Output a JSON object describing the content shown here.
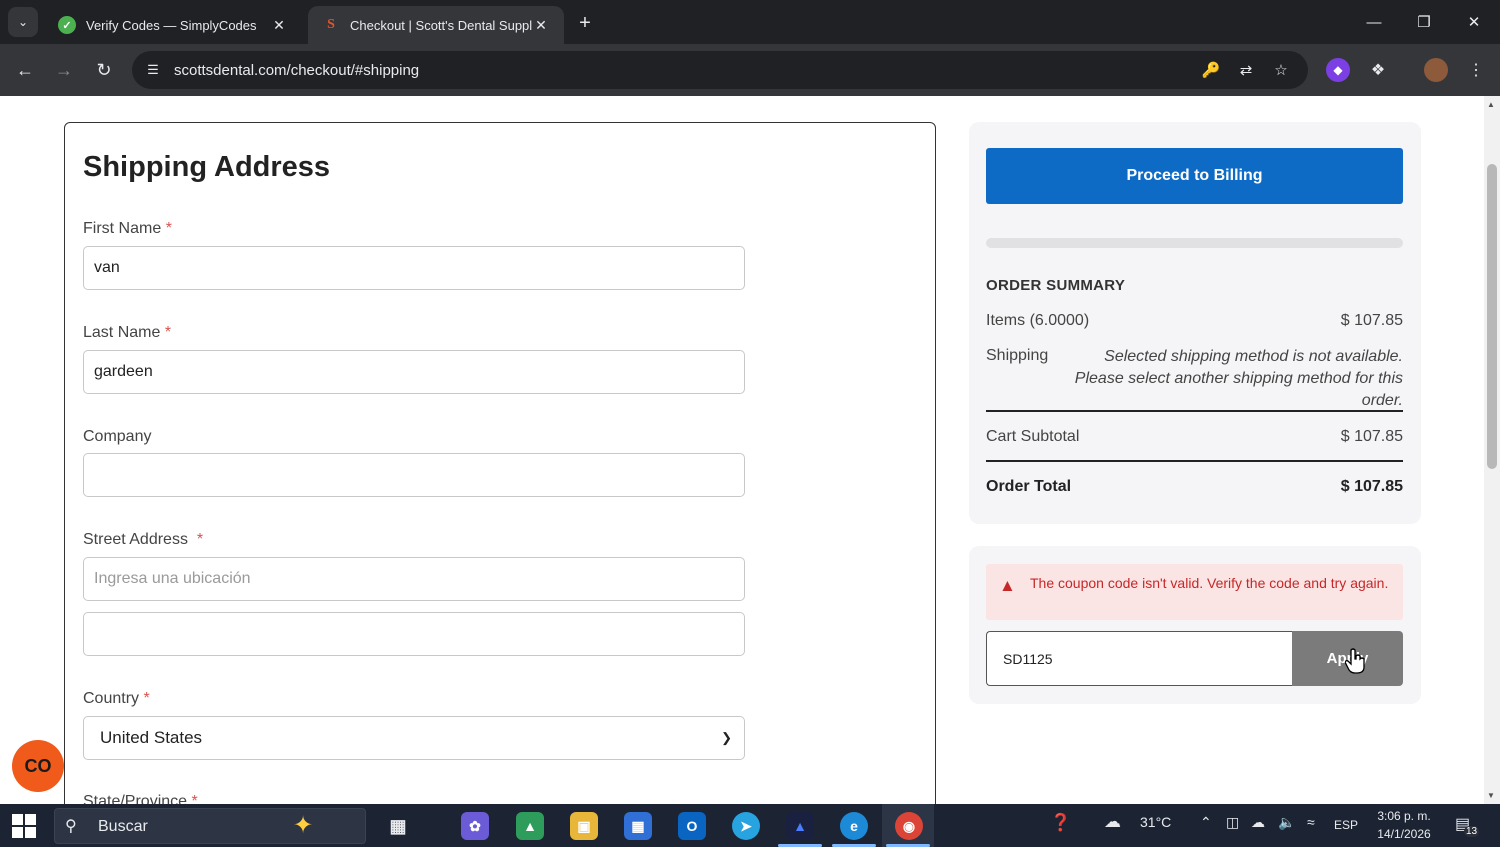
{
  "browser": {
    "tabs": [
      {
        "title": "Verify Codes — SimplyCodes",
        "active": false
      },
      {
        "title": "Checkout | Scott's Dental Suppl",
        "active": true
      }
    ],
    "url": "scottsdental.com/checkout/#shipping"
  },
  "shipping": {
    "title": "Shipping Address",
    "first_name_label": "First Name",
    "first_name_value": "van",
    "last_name_label": "Last Name",
    "last_name_value": "gardeen",
    "company_label": "Company",
    "company_value": "",
    "street_label": "Street Address",
    "street_placeholder": "Ingresa una ubicación",
    "street_line2_value": "",
    "country_label": "Country",
    "country_value": "United States",
    "state_label": "State/Province",
    "required_mark": "*"
  },
  "summary": {
    "proceed_label": "Proceed to Billing",
    "heading": "ORDER SUMMARY",
    "items_label": "Items (6.0000)",
    "items_value": "$ 107.85",
    "shipping_label": "Shipping",
    "shipping_note": "Selected shipping method is not available. Please select another shipping method for this order.",
    "subtotal_label": "Cart Subtotal",
    "subtotal_value": "$ 107.85",
    "total_label": "Order Total",
    "total_value": "$ 107.85"
  },
  "coupon": {
    "error": "The coupon code isn't valid. Verify the code and try again.",
    "code": "SD1125",
    "apply_label": "Apply"
  },
  "chat_widget": {
    "label": "CO"
  },
  "taskbar": {
    "search": "Buscar",
    "temperature": "31°C",
    "language": "ESP",
    "time": "3:06 p. m.",
    "date": "14/1/2026",
    "notifications": "13"
  },
  "colors": {
    "primary_button": "#0d6bc6",
    "error_text": "#c62828",
    "error_bg": "#fbe4e4",
    "chat_widget": "#f05a1a"
  }
}
